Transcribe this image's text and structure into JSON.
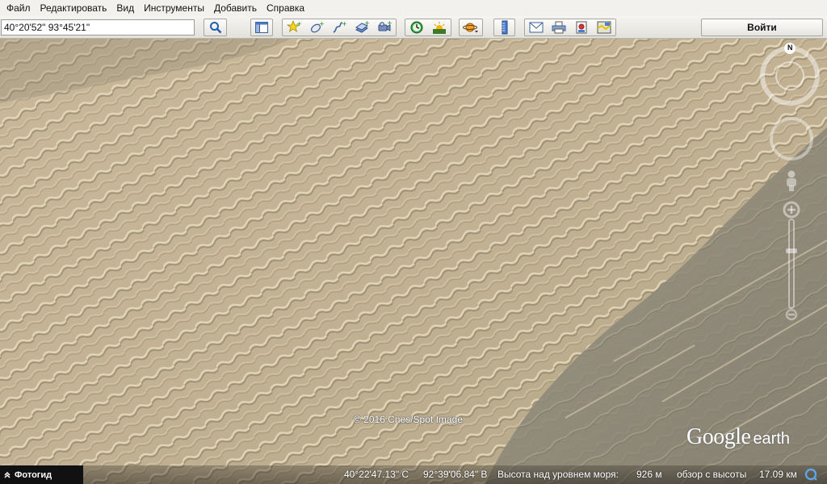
{
  "menu": {
    "items": [
      "Файл",
      "Редактировать",
      "Вид",
      "Инструменты",
      "Добавить",
      "Справка"
    ]
  },
  "search": {
    "value": "40°20'52\" 93°45'21\""
  },
  "toolbar": {
    "login_label": "Войти"
  },
  "map": {
    "copyright": "© 2016 Cnes/Spot Image",
    "logo_google": "Google",
    "logo_earth": "earth",
    "compass_letter": "N"
  },
  "status": {
    "photo_tour": "Фотогид",
    "latitude": "40°22'47.13\" С",
    "longitude": "92°39'06.84\" В",
    "elevation_label": "Высота над уровнем моря:",
    "elevation_value": "926 м",
    "eye_alt_label": "обзор с высоты",
    "eye_alt_value": "17.09 км"
  },
  "colors": {
    "sand_light": "#d6c3a3",
    "sand_shadow": "#8e8266",
    "plain": "#8b8678",
    "accent_blue": "#1f6fd0"
  }
}
